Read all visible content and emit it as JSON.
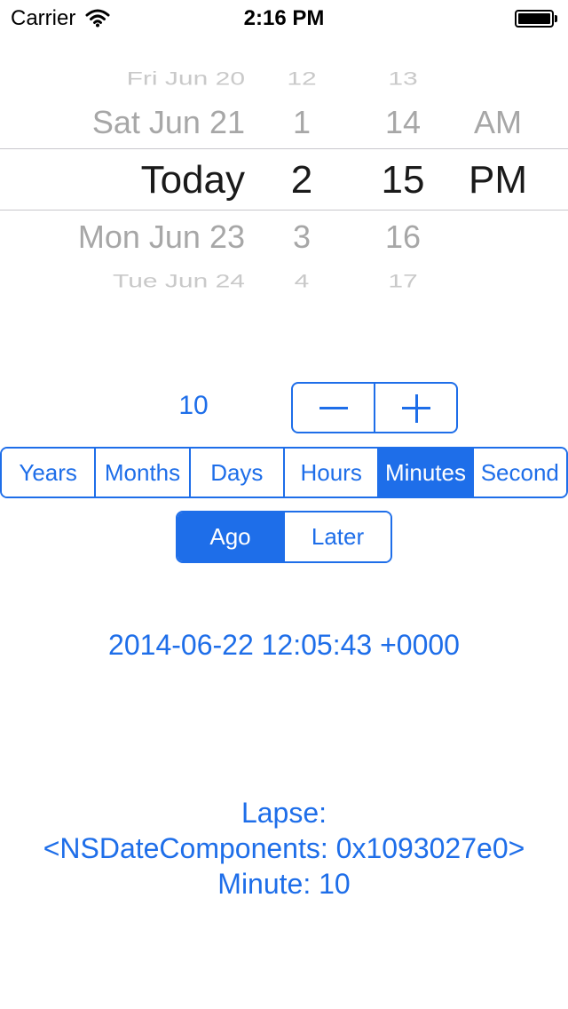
{
  "status_bar": {
    "carrier": "Carrier",
    "time": "2:16 PM",
    "battery_level": 1.0
  },
  "picker": {
    "date_column": [
      "Fri Jun 20",
      "Sat Jun 21",
      "Today",
      "Mon Jun 23",
      "Tue Jun 24"
    ],
    "hour_column": [
      "12",
      "1",
      "2",
      "3",
      "4"
    ],
    "minute_column": [
      "13",
      "14",
      "15",
      "16",
      "17"
    ],
    "ampm_column": [
      "AM",
      "PM"
    ],
    "selected": {
      "date": "Today",
      "hour": "2",
      "minute": "15",
      "ampm": "PM"
    }
  },
  "stepper": {
    "value": "10",
    "minus_icon": "minus-icon",
    "plus_icon": "plus-icon"
  },
  "unit_segments": {
    "items": [
      "Years",
      "Months",
      "Days",
      "Hours",
      "Minutes",
      "Second"
    ],
    "selected": "Minutes"
  },
  "direction_segments": {
    "items": [
      "Ago",
      "Later"
    ],
    "selected": "Ago"
  },
  "result": {
    "date": "2014-06-22 12:05:43 +0000",
    "lapse_lines": [
      "Lapse:",
      "<NSDateComponents: 0x1093027e0>",
      "Minute: 10"
    ]
  },
  "colors": {
    "accent": "#1e6ee9",
    "picker_selected_text": "#1a1a1a",
    "picker_near_text": "#a7a7a7",
    "picker_far_text": "#c9c9c9",
    "separator": "#c8c7cc"
  }
}
